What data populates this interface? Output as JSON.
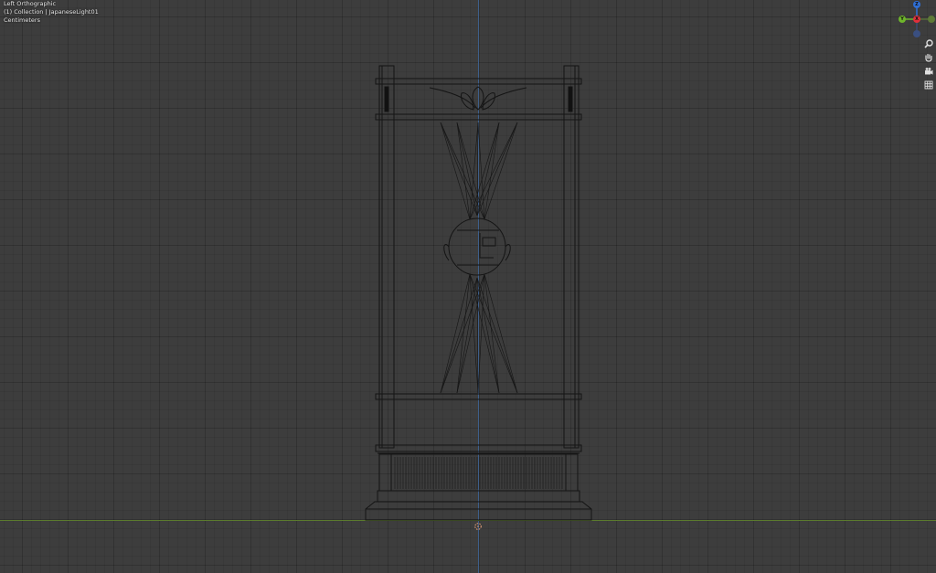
{
  "viewport": {
    "view_name": "Left Orthographic",
    "collection_info": "(1) Collection | JapaneseLight01",
    "units": "Centimeters"
  },
  "gizmo": {
    "axes": [
      {
        "label": "Z",
        "color": "#2f6fd6"
      },
      {
        "label": "Y",
        "color": "#6eb52b"
      },
      {
        "label": "X",
        "color": "#e0303b"
      },
      {
        "label": "",
        "color": "#3a4f80"
      },
      {
        "label": "",
        "color": "#5e7a36"
      }
    ]
  },
  "tools": [
    {
      "name": "zoom",
      "icon": "magnifier-icon"
    },
    {
      "name": "pan",
      "icon": "hand-icon"
    },
    {
      "name": "camera",
      "icon": "camera-icon"
    },
    {
      "name": "ortho-toggle",
      "icon": "grid-icon"
    }
  ],
  "colors": {
    "background": "#3d3d3d",
    "wire": "#111111",
    "axis_y": "#3e5f8a",
    "axis_x": "#5b7a2e"
  }
}
